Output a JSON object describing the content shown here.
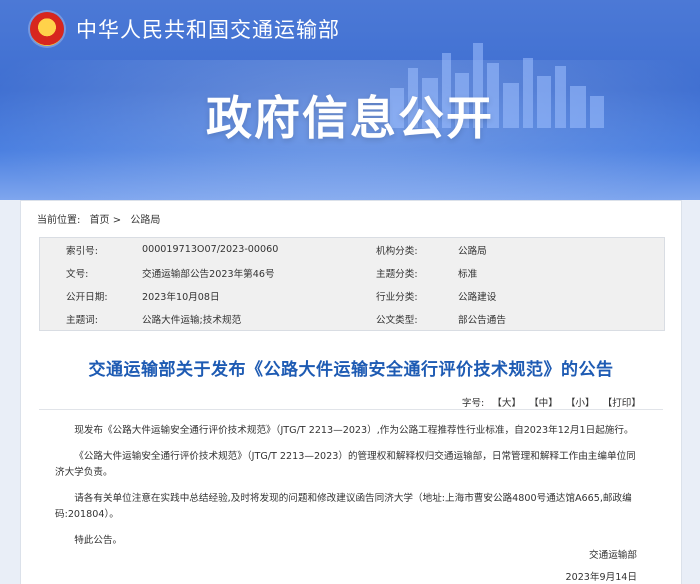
{
  "header": {
    "ministry_name": "中华人民共和国交通运输部",
    "banner_title": "政府信息公开"
  },
  "breadcrumb": {
    "label": "当前位置:",
    "home": "首页",
    "separator": ">",
    "current": "公路局"
  },
  "meta": {
    "rows": [
      {
        "k1": "索引号:",
        "v1": "000019713O07/2023-00060",
        "k2": "机构分类:",
        "v2": "公路局"
      },
      {
        "k1": "文号:",
        "v1": "交通运输部公告2023年第46号",
        "k2": "主题分类:",
        "v2": "标准"
      },
      {
        "k1": "公开日期:",
        "v1": "2023年10月08日",
        "k2": "行业分类:",
        "v2": "公路建设"
      },
      {
        "k1": "主题词:",
        "v1": "公路大件运输;技术规范",
        "k2": "公文类型:",
        "v2": "部公告通告"
      }
    ]
  },
  "article": {
    "title": "交通运输部关于发布《公路大件运输安全通行评价技术规范》的公告",
    "font_size_label": "字号:",
    "size_large": "【大】",
    "size_medium": "【中】",
    "size_small": "【小】",
    "print": "【打印】",
    "paragraphs": [
      "现发布《公路大件运输安全通行评价技术规范》（JTG/T 2213—2023）,作为公路工程推荐性行业标准，自2023年12月1日起施行。",
      "《公路大件运输安全通行评价技术规范》（JTG/T 2213—2023）的管理权和解释权归交通运输部，日常管理和解释工作由主编单位同济大学负责。",
      "请各有关单位注意在实践中总结经验,及时将发现的问题和修改建议函告同济大学（地址:上海市曹安公路4800号通达馆A665,邮政编码:201804）。",
      "特此公告。"
    ],
    "signature": "交通运输部",
    "date": "2023年9月14日"
  },
  "colors": {
    "banner": "#4c79d6",
    "title": "#1e5bb3",
    "meta_bg": "#f0f0f0"
  }
}
